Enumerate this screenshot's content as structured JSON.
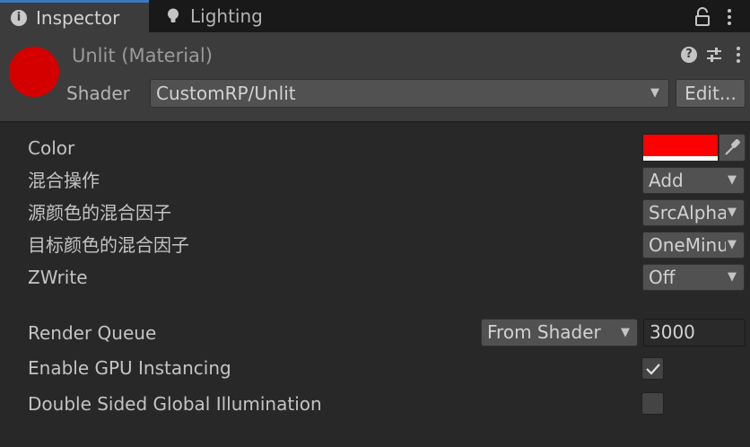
{
  "tabs": [
    {
      "label": "Inspector",
      "icon": "info-icon",
      "active": true
    },
    {
      "label": "Lighting",
      "icon": "lightbulb-icon",
      "active": false
    }
  ],
  "tabbar": {
    "lock_icon": "lock-icon",
    "menu_icon": "kebab-menu-icon"
  },
  "header": {
    "title": "Unlit (Material)",
    "preview_color": "#d40000",
    "help_glyph": "?",
    "shader_label": "Shader",
    "shader_value": "CustomRP/Unlit",
    "edit_label": "Edit..."
  },
  "properties": {
    "color": {
      "label": "Color",
      "value": "#ff0000"
    },
    "blend_op": {
      "label": "混合操作",
      "value": "Add"
    },
    "src_blend": {
      "label": "源颜色的混合因子",
      "value": "SrcAlpha"
    },
    "dst_blend": {
      "label": "目标颜色的混合因子",
      "value": "OneMinusSrcAlpha"
    },
    "zwrite": {
      "label": "ZWrite",
      "value": "Off"
    }
  },
  "render_queue": {
    "label": "Render Queue",
    "mode": "From Shader",
    "value": "3000"
  },
  "gpu_instancing": {
    "label": "Enable GPU Instancing",
    "checked": true
  },
  "dsgi": {
    "label": "Double Sided Global Illumination",
    "checked": false
  },
  "caret": "▼",
  "accent": "#3a79bb"
}
